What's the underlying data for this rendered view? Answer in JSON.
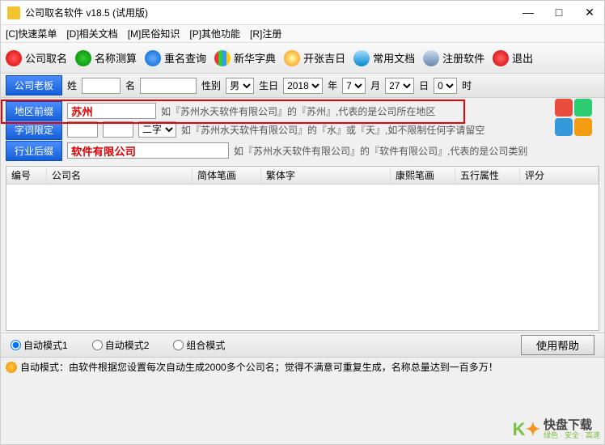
{
  "window": {
    "title": "公司取名软件 v18.5 (试用版)",
    "controls": {
      "min": "—",
      "max": "□",
      "close": "✕"
    }
  },
  "menu": {
    "items": [
      "[C]快速菜单",
      "[D]相关文档",
      "[M]民俗知识",
      "[P]其他功能",
      "[R]注册"
    ]
  },
  "toolbar": {
    "items": [
      {
        "label": "公司取名"
      },
      {
        "label": "名称测算"
      },
      {
        "label": "重名查询"
      },
      {
        "label": "新华字典"
      },
      {
        "label": "开张吉日"
      },
      {
        "label": "常用文档"
      },
      {
        "label": "注册软件"
      },
      {
        "label": "退出"
      }
    ]
  },
  "form": {
    "boss_tab": "公司老板",
    "surname_label": "姓",
    "surname": "",
    "given_label": "名",
    "given": "",
    "gender_label": "性别",
    "gender": "男",
    "birth_label": "生日",
    "year": "2018",
    "year_suf": "年",
    "month": "7",
    "month_suf": "月",
    "day": "27",
    "day_suf": "日",
    "hour": "0",
    "hour_suf": "时"
  },
  "config": {
    "region_tab": "地区前缀",
    "region_value": "苏州",
    "region_hint": "如『苏州水天软件有限公司』的『苏州』,代表的是公司所在地区",
    "wordlimit_tab": "字词限定",
    "wordlimit_v1": "",
    "wordlimit_v2": "",
    "wordlimit_sel": "二字",
    "wordlimit_hint": "如『苏州水天软件有限公司』的『水』或『天』,如不限制任何字请留空",
    "industry_tab": "行业后缀",
    "industry_value": "软件有限公司",
    "industry_hint": "如『苏州水天软件有限公司』的『软件有限公司』,代表的是公司类别"
  },
  "table": {
    "cols": [
      "编号",
      "公司名",
      "简体笔画",
      "繁体字",
      "康熙笔画",
      "五行属性",
      "评分"
    ]
  },
  "modes": {
    "m1": "自动模式1",
    "m2": "自动模式2",
    "m3": "组合模式",
    "help_btn": "使用帮助"
  },
  "status": {
    "text": "自动模式：由软件根据您设置每次自动生成2000多个公司名；觉得不满意可重复生成，名称总量达到一百多万！"
  },
  "watermark": {
    "brand_big": "快盘下载",
    "brand_small": "绿色 · 安全 · 高速"
  }
}
